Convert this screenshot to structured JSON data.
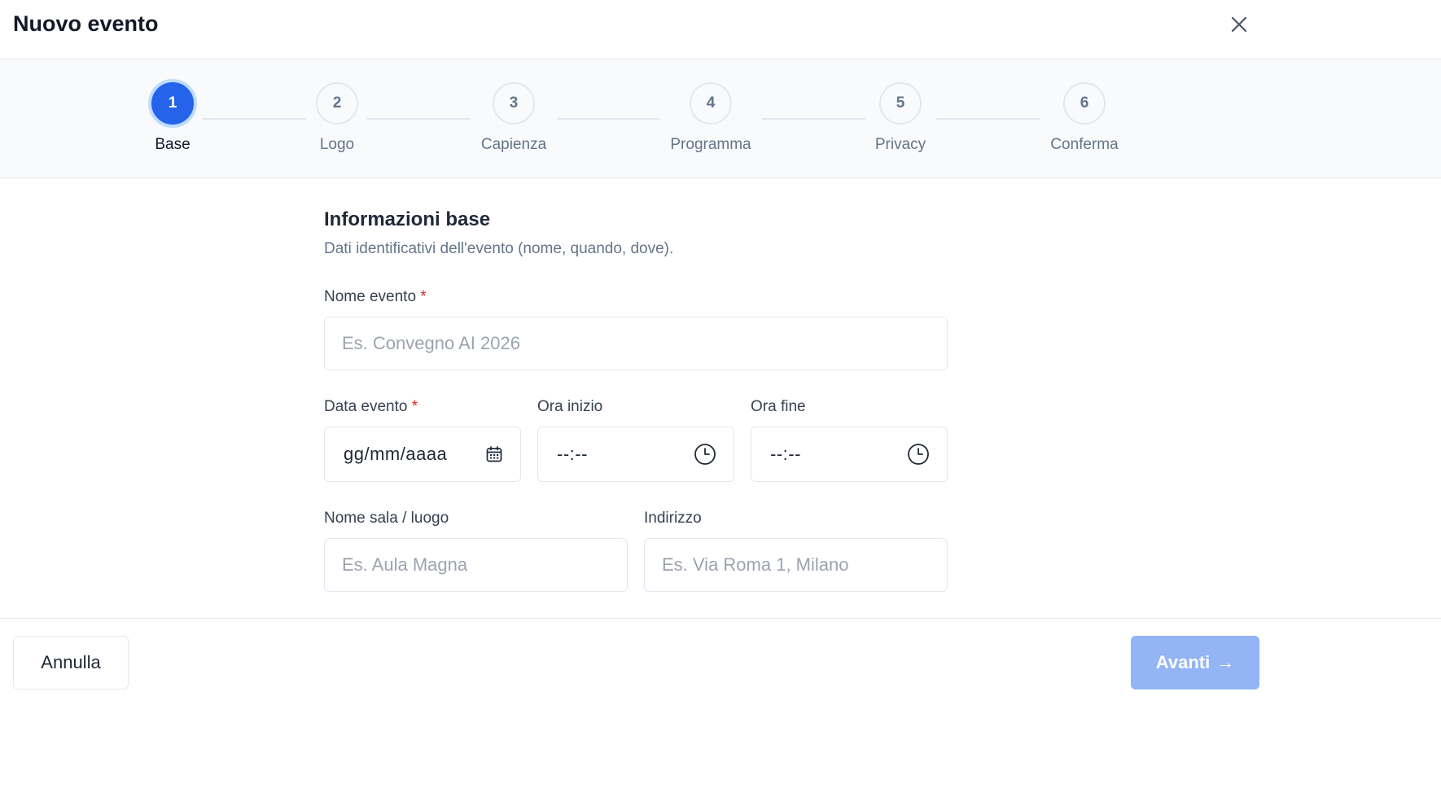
{
  "header": {
    "title": "Nuovo evento",
    "close_icon": "close-icon"
  },
  "stepper": {
    "steps": [
      {
        "number": "1",
        "label": "Base",
        "active": true
      },
      {
        "number": "2",
        "label": "Logo",
        "active": false
      },
      {
        "number": "3",
        "label": "Capienza",
        "active": false
      },
      {
        "number": "4",
        "label": "Programma",
        "active": false
      },
      {
        "number": "5",
        "label": "Privacy",
        "active": false
      },
      {
        "number": "6",
        "label": "Conferma",
        "active": false
      }
    ],
    "active_color": "#2563eb"
  },
  "form": {
    "title": "Informazioni base",
    "description": "Dati identificativi dell'evento (nome, quando, dove).",
    "required_marker": "*",
    "name": {
      "label": "Nome evento",
      "placeholder": "Es. Convegno AI 2026",
      "value": ""
    },
    "date": {
      "label": "Data evento",
      "value": "gg/mm/aaaa",
      "icon": "calendar-icon"
    },
    "start_time": {
      "label": "Ora inizio",
      "value": "--:--",
      "icon": "clock-icon"
    },
    "end_time": {
      "label": "Ora fine",
      "value": "--:--",
      "icon": "clock-icon"
    },
    "venue": {
      "label": "Nome sala / luogo",
      "placeholder": "Es. Aula Magna",
      "value": ""
    },
    "address": {
      "label": "Indirizzo",
      "placeholder": "Es. Via Roma 1, Milano",
      "value": ""
    }
  },
  "footer": {
    "cancel_label": "Annulla",
    "next_label": "Avanti",
    "next_arrow": "→"
  }
}
